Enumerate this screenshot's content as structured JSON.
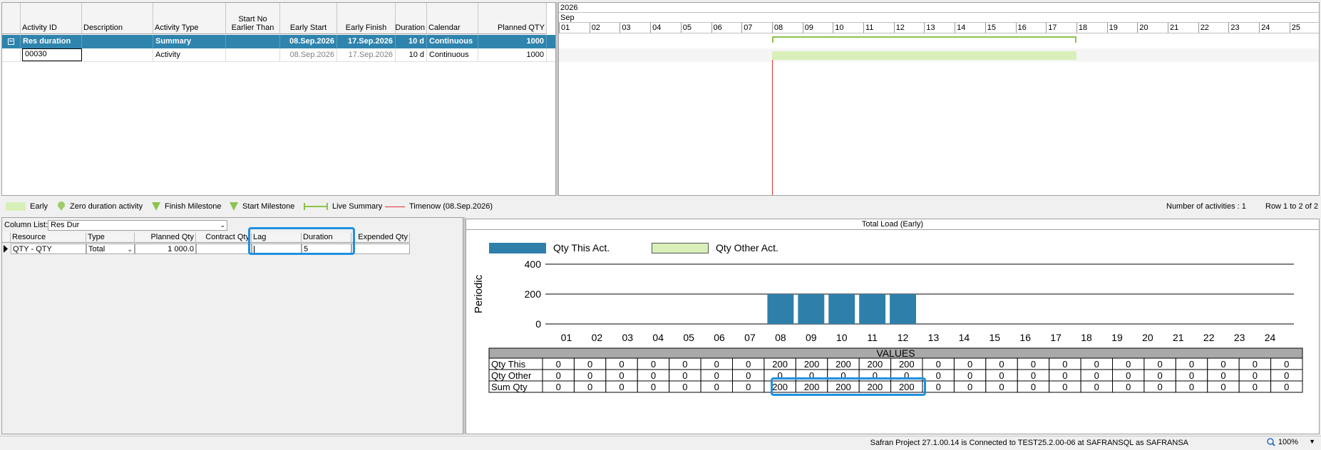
{
  "grid": {
    "headers": [
      "Activity ID",
      "Description",
      "Activity Type",
      "Start No Earlier Than",
      "Early Start",
      "Early Finish",
      "Duration",
      "Calendar",
      "Planned QTY"
    ],
    "summary_row": {
      "expander": "−",
      "activity_id": "Res duration",
      "description": "",
      "activity_type": "Summary",
      "start_no_earlier": "",
      "early_start": "08.Sep.2026",
      "early_finish": "17.Sep.2026",
      "duration": "10 d",
      "calendar": "Continuous",
      "planned_qty": "1000"
    },
    "activity_row": {
      "activity_id": "00030",
      "description": "",
      "activity_type": "Activity",
      "start_no_earlier": "",
      "early_start": "08.Sep.2026",
      "early_finish": "17.Sep.2026",
      "duration": "10 d",
      "calendar": "Continuous",
      "planned_qty": "1000"
    }
  },
  "gantt": {
    "year": "2026",
    "month": "Sep",
    "days": [
      "01",
      "02",
      "03",
      "04",
      "05",
      "06",
      "07",
      "08",
      "09",
      "10",
      "11",
      "12",
      "13",
      "14",
      "15",
      "16",
      "17",
      "18",
      "19",
      "20",
      "21",
      "22",
      "23",
      "24",
      "25"
    ],
    "colors": {
      "early_bar": "#d9efb9",
      "summary_line": "#8cc34a",
      "timenow": "#e03030"
    }
  },
  "legend": {
    "early": "Early",
    "zero_duration": "Zero duration activity",
    "finish_milestone": "Finish Milestone",
    "start_milestone": "Start Milestone",
    "live_summary": "Live Summary",
    "timenow": "Timenow (08.Sep.2026)",
    "activity_count": "Number of activities : 1",
    "row_range": "Row 1 to 2 of 2"
  },
  "resources": {
    "column_list_label": "Column List:",
    "column_list_value": "Res Dur",
    "headers": [
      "Resource",
      "Type",
      "Planned Qty",
      "Contract Qty",
      "Lag",
      "Duration",
      "Expended Qty"
    ],
    "row": {
      "resource": "QTY - QTY",
      "type": "Total",
      "planned_qty": "1 000.0",
      "contract_qty": "",
      "lag": "",
      "duration": "5",
      "expended_qty": ""
    }
  },
  "load_chart": {
    "title": "Total Load (Early)",
    "legend_this": "Qty This Act.",
    "legend_other": "Qty Other Act.",
    "ylabel": "Periodic",
    "values_header": "VALUES",
    "row_labels": [
      "Qty This",
      "Qty Other",
      "Sum Qty"
    ],
    "colors": {
      "this_act": "#2f7fab",
      "other_act": "#d9efb9"
    }
  },
  "chart_data": {
    "type": "bar",
    "title": "Total Load (Early)",
    "xlabel": "",
    "ylabel": "Periodic",
    "ylim": [
      0,
      400
    ],
    "yticks": [
      0,
      200,
      400
    ],
    "grid": true,
    "legend": "top-left",
    "categories": [
      "01",
      "02",
      "03",
      "04",
      "05",
      "06",
      "07",
      "08",
      "09",
      "10",
      "11",
      "12",
      "13",
      "14",
      "15",
      "16",
      "17",
      "18",
      "19",
      "20",
      "21",
      "22",
      "23",
      "24"
    ],
    "series": [
      {
        "name": "Qty This Act.",
        "values": [
          0,
          0,
          0,
          0,
          0,
          0,
          0,
          200,
          200,
          200,
          200,
          200,
          0,
          0,
          0,
          0,
          0,
          0,
          0,
          0,
          0,
          0,
          0,
          0
        ]
      },
      {
        "name": "Qty Other Act.",
        "values": [
          0,
          0,
          0,
          0,
          0,
          0,
          0,
          0,
          0,
          0,
          0,
          0,
          0,
          0,
          0,
          0,
          0,
          0,
          0,
          0,
          0,
          0,
          0,
          0
        ]
      }
    ],
    "sum": [
      0,
      0,
      0,
      0,
      0,
      0,
      0,
      200,
      200,
      200,
      200,
      200,
      0,
      0,
      0,
      0,
      0,
      0,
      0,
      0,
      0,
      0,
      0,
      0
    ]
  },
  "status": {
    "connection": "Safran Project 27.1.00.14 is Connected to TEST25.2.00-06 at SAFRANSQL as SAFRANSA",
    "zoom": "100%"
  }
}
